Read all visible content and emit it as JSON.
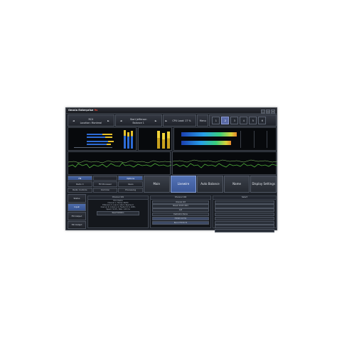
{
  "window": {
    "title": "Omnia Enterprise",
    "title_suffix": "9s",
    "buttons": [
      "_",
      "□",
      "×"
    ]
  },
  "toolbar": {
    "prev_arrow": "◄",
    "next_arrow": "►",
    "station_title": "RCX",
    "station_location": "Location: Montreal",
    "preset_title": "Start Jefferson",
    "preset_sub": "Balance 1",
    "cpu_label": "CPU Load: 17 %",
    "menu_label": "Menu",
    "presets": [
      "1",
      "2",
      "3",
      "4",
      "5",
      "6"
    ],
    "active_preset": "2"
  },
  "nav": {
    "grid": [
      {
        "label": "FM",
        "selected": true
      },
      {
        "label": "",
        "selected": false
      },
      {
        "label": "Options",
        "selected": true
      },
      {
        "label": "Radio C",
        "selected": false
      },
      {
        "label": "FM Processor",
        "selected": false
      },
      {
        "label": "Users",
        "selected": false
      },
      {
        "label": "Radio Controls",
        "selected": false
      },
      {
        "label": "Common",
        "selected": false
      },
      {
        "label": "Processing",
        "selected": false
      }
    ],
    "tabs": [
      {
        "label": "Main",
        "active": false
      },
      {
        "label": "Livewire",
        "active": true
      },
      {
        "label": "Auto Balance",
        "active": false
      },
      {
        "label": "Name",
        "active": false
      },
      {
        "label": "Display Settings",
        "active": false
      }
    ]
  },
  "side": [
    "Status",
    "Input",
    "FM Output",
    "HD Output"
  ],
  "status_panel": {
    "heading": "Channel 101",
    "lines": [
      "FM 2 Matrix",
      "Channel 1 / Stereo 44kHz",
      "Extension 0, Loss 0, Late 0, Resolve 0",
      "Overrun 0, Underrun 0, Faults 0 0 0, 100%",
      "Speed: 32.0%, Rate: 1.00 ms"
    ],
    "button": "Reset Statistics"
  },
  "source_panel": {
    "heading": "Channel 104",
    "fields": [
      "Channel 103",
      "Stream 00133 2015",
      "Add",
      "Destination Name",
      "FM MPX 00 T01",
      "Bind 2 FM HD TX"
    ]
  },
  "right_panel": {
    "heading": "Select"
  }
}
